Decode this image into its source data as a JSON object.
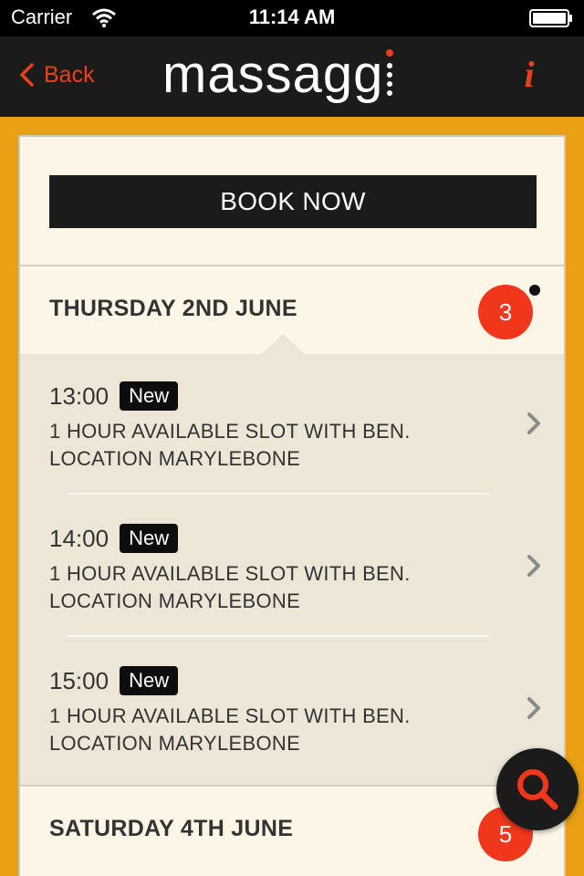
{
  "status_bar": {
    "carrier": "Carrier",
    "time": "11:14 AM"
  },
  "nav": {
    "back_label": "Back",
    "brand": "massagg",
    "info_label": "i"
  },
  "book_now_label": "BOOK NOW",
  "days": [
    {
      "title": "THURSDAY 2ND JUNE",
      "count": "3",
      "expanded": true,
      "slots": [
        {
          "time": "13:00",
          "badge": "New",
          "line1": "1 HOUR AVAILABLE SLOT WITH BEN.",
          "line2": "LOCATION MARYLEBONE"
        },
        {
          "time": "14:00",
          "badge": "New",
          "line1": "1 HOUR AVAILABLE SLOT WITH BEN.",
          "line2": "LOCATION MARYLEBONE"
        },
        {
          "time": "15:00",
          "badge": "New",
          "line1": "1 HOUR AVAILABLE SLOT WITH BEN.",
          "line2": "LOCATION MARYLEBONE"
        }
      ]
    },
    {
      "title": "SATURDAY 4TH JUNE",
      "count": "5",
      "expanded": false
    }
  ],
  "colors": {
    "accent": "#f0371c",
    "nav_background": "#1b1b1b",
    "page_background": "#e8a012",
    "card_background": "#fdf6e6",
    "slot_background": "#ede5d6"
  },
  "icons": {
    "back": "chevron-left-icon",
    "info": "info-icon",
    "slot": "chevron-right-icon",
    "fab": "search-icon"
  }
}
